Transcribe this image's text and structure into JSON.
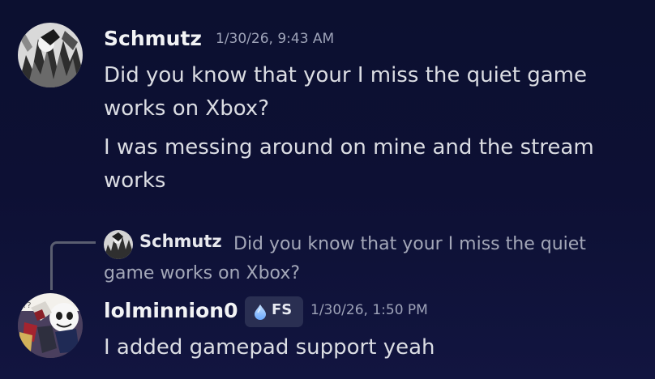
{
  "messages": [
    {
      "author": "Schmutz",
      "timestamp": "1/30/26, 9:43 AM",
      "lines": [
        "Did you know that your I miss the quiet game works on Xbox?",
        "I was messing around on mine and the stream works"
      ],
      "avatar_icon": "avatar-schmutz"
    },
    {
      "reply": {
        "author": "Schmutz",
        "text": "Did you know that your I miss the quiet game works on Xbox?"
      },
      "author": "lolminnion0",
      "badge": {
        "label": "FS",
        "icon": "water-drop-icon"
      },
      "timestamp": "1/30/26, 1:50 PM",
      "lines": [
        "I added gamepad support yeah"
      ],
      "avatar_icon": "avatar-lolminnion0"
    }
  ]
}
